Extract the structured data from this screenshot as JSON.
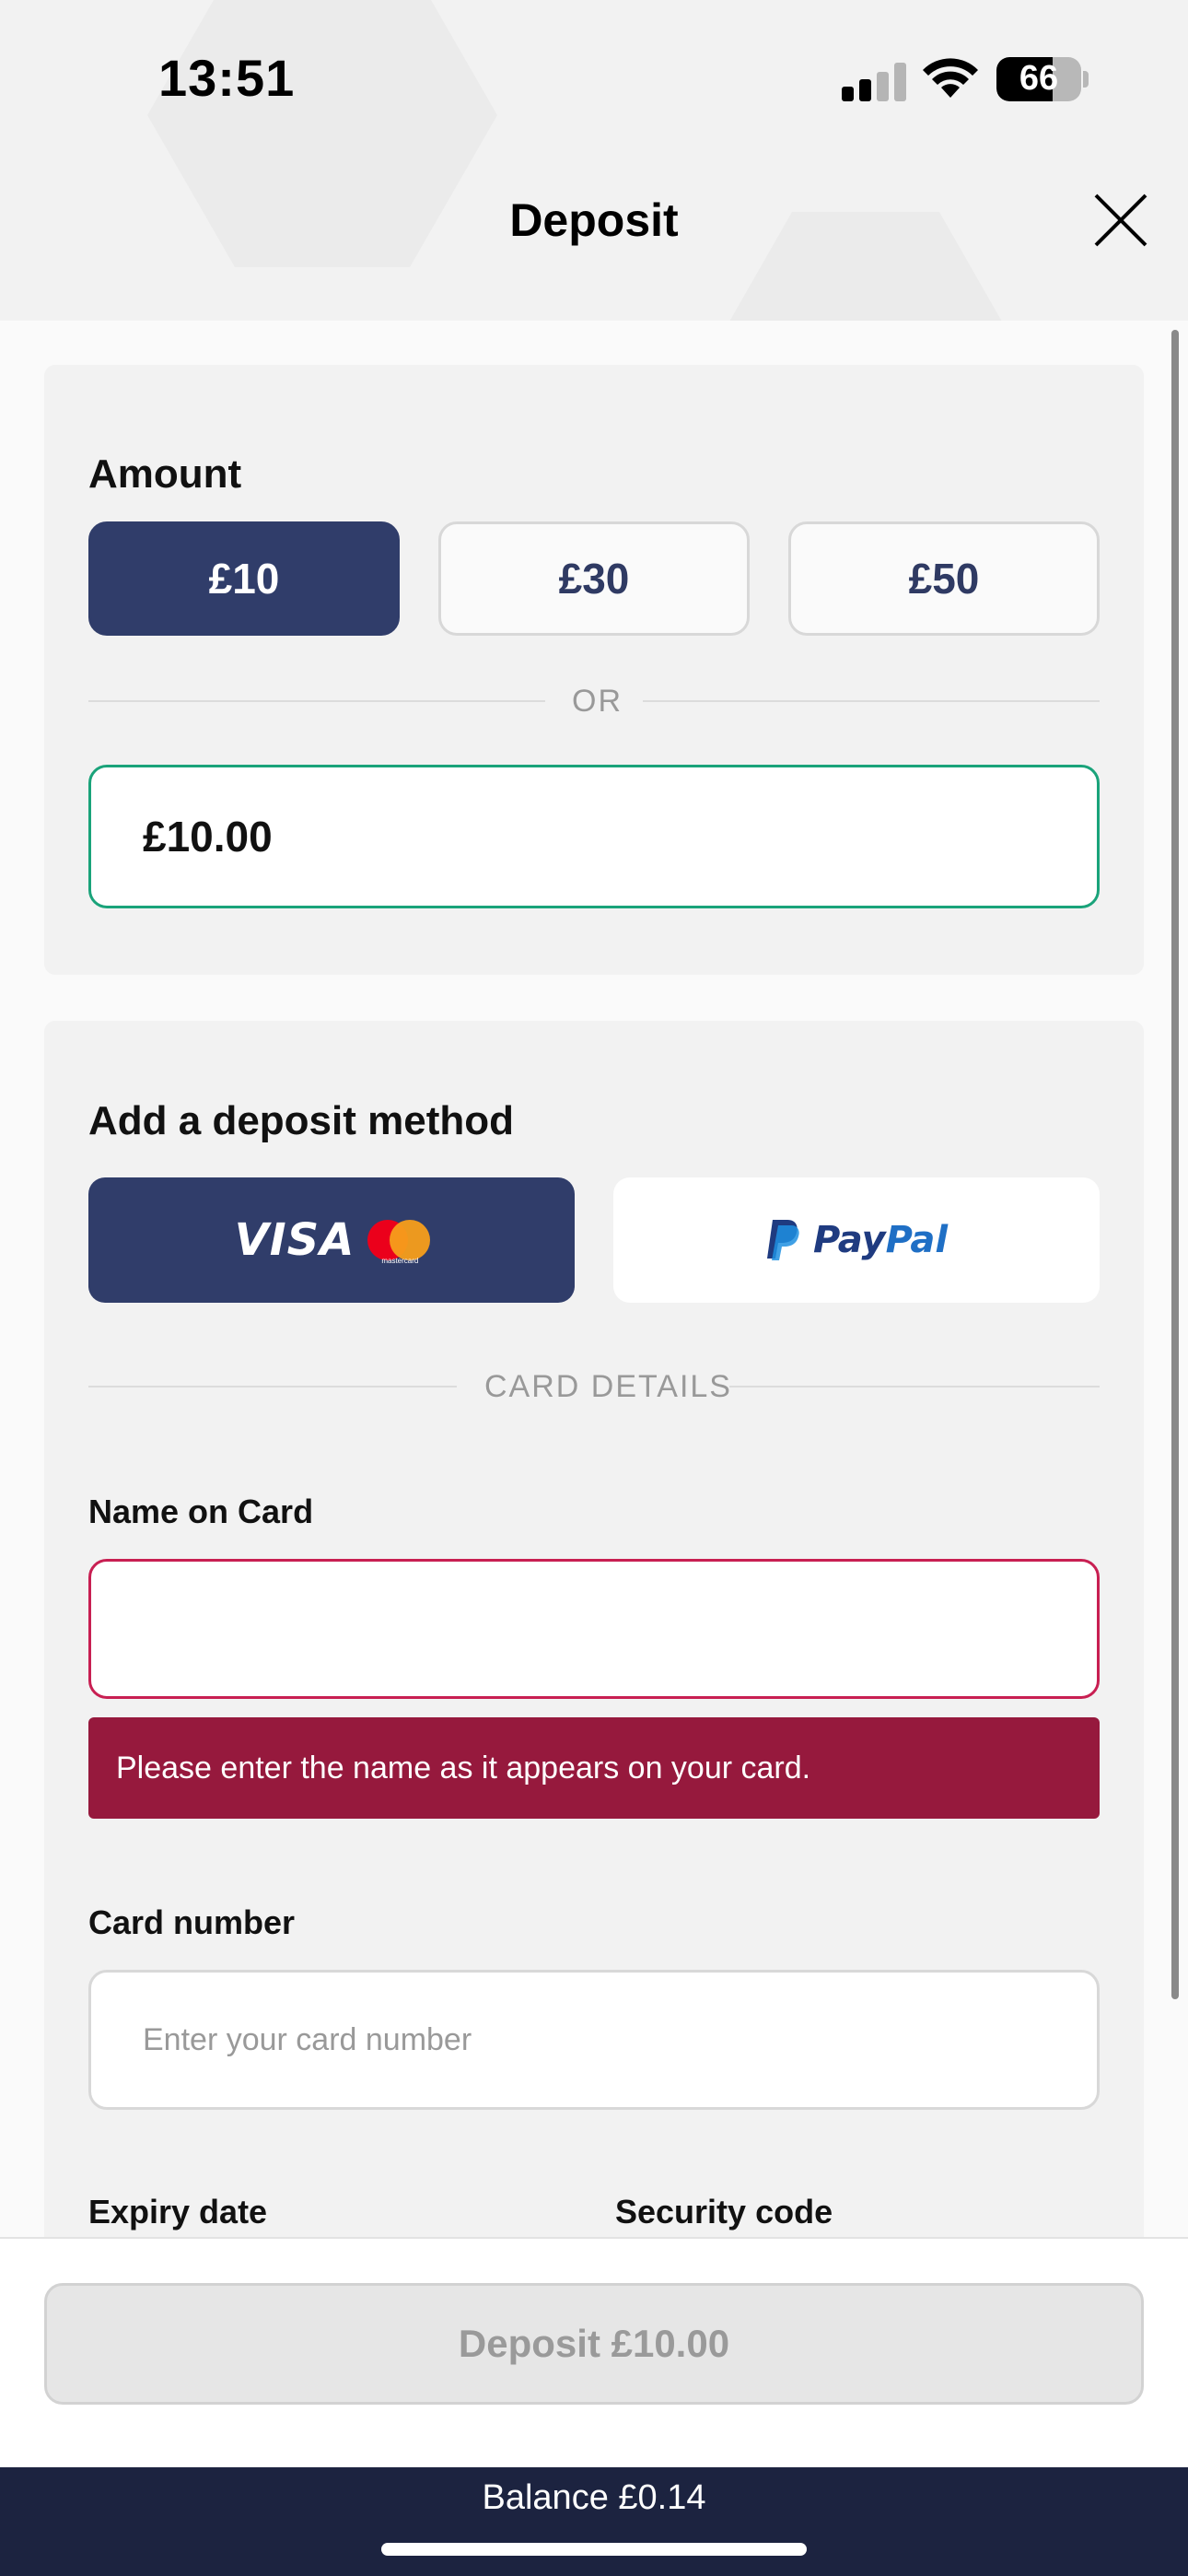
{
  "status_bar": {
    "time": "13:51",
    "battery": "66",
    "battery_level": 0.66,
    "signal_bars_active": 2,
    "signal_bars_total": 4
  },
  "header": {
    "title": "Deposit",
    "close_icon": "close-icon"
  },
  "amount": {
    "title": "Amount",
    "presets": [
      {
        "label": "£10",
        "selected": true
      },
      {
        "label": "£30",
        "selected": false
      },
      {
        "label": "£50",
        "selected": false
      }
    ],
    "or_label": "OR",
    "value": "£10.00"
  },
  "method": {
    "title": "Add a deposit method",
    "card_option": {
      "visa_label": "VISA",
      "mastercard_label": "mastercard",
      "selected": true
    },
    "paypal_option": {
      "label_pay": "Pay",
      "label_pal": "Pal",
      "selected": false
    },
    "card_details_label": "CARD DETAILS",
    "name_on_card": {
      "label": "Name on Card",
      "value": "",
      "error": "Please enter the name as it appears on your card."
    },
    "card_number": {
      "label": "Card number",
      "placeholder": "Enter your card number"
    },
    "expiry_label": "Expiry date",
    "security_label": "Security code"
  },
  "footer": {
    "deposit_button": "Deposit £10.00",
    "balance": "Balance £0.14"
  },
  "colors": {
    "primary": "#303d6a",
    "valid_border": "#1aa37a",
    "error_border": "#c81f52",
    "error_bg": "#96193d",
    "balance_bar": "#1c2340"
  }
}
